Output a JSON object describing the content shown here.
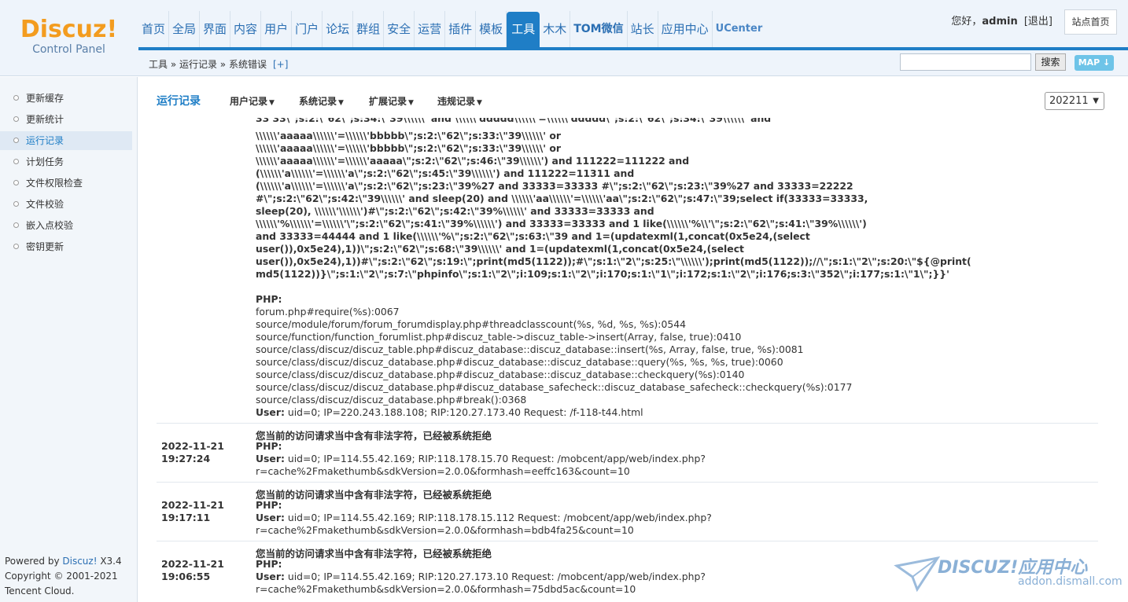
{
  "header": {
    "logo_brand": "Discuz!",
    "logo_sub": "Control Panel",
    "nav": [
      "首页",
      "全局",
      "界面",
      "内容",
      "用户",
      "门户",
      "论坛",
      "群组",
      "安全",
      "运营",
      "插件",
      "模板",
      "工具",
      "木木",
      "TOM微信",
      "站长",
      "应用中心",
      "UCenter"
    ],
    "active_nav": "工具",
    "greeting_prefix": "您好，",
    "username": "admin",
    "logout": "[退出]",
    "site_home": "站点首页",
    "breadcrumb": "工具 » 运行记录 » 系统错误",
    "breadcrumb_add": "[+]",
    "search_button": "搜索",
    "map_button": "MAP ↓"
  },
  "sidebar": {
    "items": [
      "更新缓存",
      "更新统计",
      "运行记录",
      "计划任务",
      "文件权限检查",
      "文件校验",
      "嵌入点校验",
      "密钥更新"
    ],
    "active": "运行记录",
    "powered_prefix": "Powered by ",
    "powered_link": "Discuz!",
    "powered_version": " X3.4",
    "copyright": "Copyright © 2001-2021",
    "company": "Tencent Cloud."
  },
  "subnav": {
    "title": "运行记录",
    "tabs": [
      "用户记录",
      "系统记录",
      "扩展记录",
      "违规记录"
    ],
    "tab_arrow": "▼",
    "date_select": "202211",
    "date_arrow": "▼"
  },
  "log": {
    "sql_lines": [
      "\\\\\\\\\\\\'aaaaa\\\\\\\\\\\\'=\\\\\\\\\\\\'bbbbb\\\";s:2:\\\"62\\\";s:33:\\\"39\\\\\\\\\\\\' or",
      "\\\\\\\\\\\\'aaaaa\\\\\\\\\\\\'=\\\\\\\\\\\\'bbbbb\\\";s:2:\\\"62\\\";s:33:\\\"39\\\\\\\\\\\\' or",
      "\\\\\\\\\\\\'aaaaa\\\\\\\\\\\\'=\\\\\\\\\\\\'aaaaa\\\";s:2:\\\"62\\\";s:46:\\\"39\\\\\\\\\\\\') and 111222=111222 and",
      "(\\\\\\\\\\\\'a\\\\\\\\\\\\'=\\\\\\\\\\\\'a\\\";s:2:\\\"62\\\";s:45:\\\"39\\\\\\\\\\\\') and 111222=11311 and",
      "(\\\\\\\\\\\\'a\\\\\\\\\\\\'=\\\\\\\\\\\\'a\\\";s:2:\\\"62\\\";s:23:\\\"39%27 and 33333=33333 #\\\";s:2:\\\"62\\\";s:23:\\\"39%27 and 33333=22222",
      "#\\\";s:2:\\\"62\\\";s:42:\\\"39\\\\\\\\\\\\' and sleep(20) and \\\\\\\\\\\\'aa\\\\\\\\\\\\'=\\\\\\\\\\\\'aa\\\";s:2:\\\"62\\\";s:47:\\\"39;select if(33333=33333,",
      "sleep(20), \\\\\\\\\\\\'\\\\\\\\\\\\')#\\\";s:2:\\\"62\\\";s:42:\\\"39%\\\\\\\\\\\\' and 33333=33333 and",
      "\\\\\\\\\\\\'%\\\\\\\\\\\\'=\\\\\\\\\\\\'\\\";s:2:\\\"62\\\";s:41:\\\"39%\\\\\\\\\\\\') and 33333=33333 and 1 like(\\\\\\\\\\\\'%\\\\'\\\";s:2:\\\"62\\\";s:41:\\\"39%\\\\\\\\\\\\')",
      "and 33333=44444 and 1 like(\\\\\\\\\\\\'%\\\";s:2:\\\"62\\\";s:63:\\\"39 and 1=(updatexml(1,concat(0x5e24,(select",
      "user()),0x5e24),1))\\\";s:2:\\\"62\\\";s:68:\\\"39\\\\\\\\\\\\' and 1=(updatexml(1,concat(0x5e24,(select",
      "user()),0x5e24),1))#\\\";s:2:\\\"62\\\";s:19:\\\";print(md5(1122));#\\\";s:1:\\\"2\\\";s:25:\\\"\\\\\\\\\\\\');print(md5(1122));//\\\";s:1:\\\"2\\\";s:20:\\\"${@print(",
      "md5(1122))}\\\";s:1:\\\"2\\\";s:7:\\\"phpinfo\\\";s:1:\\\"2\\\";i:109;s:1:\\\"2\\\";i:170;s:1:\\\"1\\\";i:172;s:1:\\\"2\\\";i:176;s:3:\\\"352\\\";i:177;s:1:\\\"1\\\";}}'"
    ],
    "php_label": "PHP:",
    "trace_lines": [
      "forum.php#require(%s):0067",
      "source/module/forum/forum_forumdisplay.php#threadclasscount(%s, %d, %s, %s):0544",
      "source/function/function_forumlist.php#discuz_table->discuz_table->insert(Array, false, true):0410",
      "source/class/discuz/discuz_table.php#discuz_database::discuz_database::insert(%s, Array, false, true, %s):0081",
      "source/class/discuz/discuz_database.php#discuz_database::discuz_database::query(%s, %s, %s, true):0060",
      "source/class/discuz/discuz_database.php#discuz_database::discuz_database::checkquery(%s):0140",
      "source/class/discuz/discuz_database.php#discuz_database_safecheck::discuz_database_safecheck::checkquery(%s):0177",
      "source/class/discuz/discuz_database.php#break():0368"
    ],
    "user_label": "User:",
    "first_user": " uid=0; IP=220.243.188.108; RIP:120.27.173.40 Request: /f-118-t44.html",
    "entries": [
      {
        "date": "2022-11-21",
        "time": "19:27:24",
        "msg": "您当前的访问请求当中含有非法字符，已经被系统拒绝",
        "user": " uid=0; IP=114.55.42.169; RIP:118.178.15.70 Request: /mobcent/app/web/index.php?",
        "request_tail": "r=cache%2Fmakethumb&sdkVersion=2.0.0&formhash=eeffc163&count=10"
      },
      {
        "date": "2022-11-21",
        "time": "19:17:11",
        "msg": "您当前的访问请求当中含有非法字符，已经被系统拒绝",
        "user": " uid=0; IP=114.55.42.169; RIP:118.178.15.112 Request: /mobcent/app/web/index.php?",
        "request_tail": "r=cache%2Fmakethumb&sdkVersion=2.0.0&formhash=bdb4fa25&count=10"
      },
      {
        "date": "2022-11-21",
        "time": "19:06:55",
        "msg": "您当前的访问请求当中含有非法字符，已经被系统拒绝",
        "user": " uid=0; IP=114.55.42.169; RIP:120.27.173.10 Request: /mobcent/app/web/index.php?",
        "request_tail": "r=cache%2Fmakethumb&sdkVersion=2.0.0&formhash=75dbd5ac&count=10"
      }
    ]
  },
  "watermark": {
    "brand": "DISCUZ!应用中心",
    "site": "addon.dismall.com"
  }
}
